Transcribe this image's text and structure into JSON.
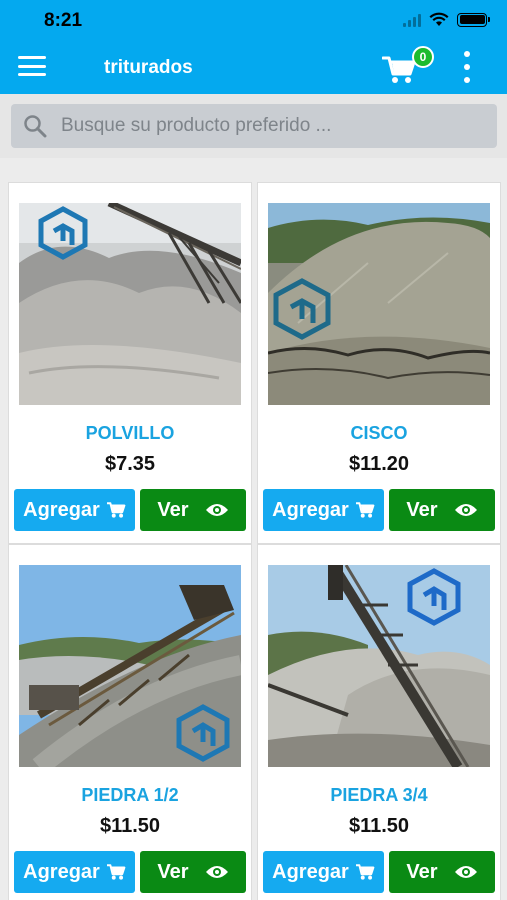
{
  "status_bar": {
    "time": "8:21"
  },
  "app_bar": {
    "title": "triturados",
    "cart_count": "0"
  },
  "search": {
    "placeholder": "Busque su producto preferido ..."
  },
  "buttons": {
    "add_label": "Agregar",
    "view_label": "Ver"
  },
  "colors": {
    "primary": "#04a9ef",
    "add_button": "#15aaf0",
    "view_button": "#0a8a14",
    "badge": "#1dbb2e",
    "product_name": "#1aa3e0"
  },
  "products": [
    {
      "name": "POLVILLO",
      "price": "$7.35"
    },
    {
      "name": "CISCO",
      "price": "$11.20"
    },
    {
      "name": "PIEDRA 1/2",
      "price": "$11.50"
    },
    {
      "name": "PIEDRA 3/4",
      "price": "$11.50"
    }
  ]
}
